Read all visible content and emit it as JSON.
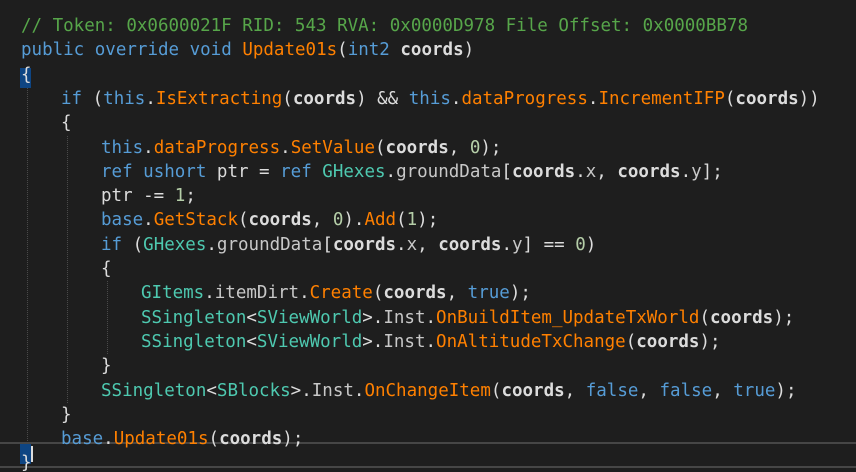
{
  "colors": {
    "background": "#1e1e1e",
    "comment": "#57a64a",
    "keyword": "#569cd6",
    "type": "#4ec9b0",
    "method": "#ff8000",
    "member": "#c8c8c8",
    "plain": "#dcdcdc",
    "number": "#b5cea8",
    "indent_guide": "#4a4a4a",
    "current_line_border": "#464646"
  },
  "code": {
    "lines": [
      {
        "indent": 0,
        "tokens": [
          [
            "c",
            "// Token: 0x0600021F RID: 543 RVA: 0x0000D978 File Offset: 0x0000BB78"
          ]
        ]
      },
      {
        "indent": 0,
        "tokens": [
          [
            "k",
            "public"
          ],
          [
            "p",
            " "
          ],
          [
            "k",
            "override"
          ],
          [
            "p",
            " "
          ],
          [
            "k",
            "void"
          ],
          [
            "p",
            " "
          ],
          [
            "m",
            "Update01s"
          ],
          [
            "p",
            "("
          ],
          [
            "k",
            "int2"
          ],
          [
            "p",
            " "
          ],
          [
            "b",
            "coords"
          ],
          [
            "p",
            ")"
          ]
        ]
      },
      {
        "indent": 0,
        "tokens": [
          [
            "p",
            "{"
          ]
        ]
      },
      {
        "indent": 1,
        "tokens": [
          [
            "k",
            "if"
          ],
          [
            "p",
            " ("
          ],
          [
            "k",
            "this"
          ],
          [
            "p",
            "."
          ],
          [
            "m",
            "IsExtracting"
          ],
          [
            "p",
            "("
          ],
          [
            "b",
            "coords"
          ],
          [
            "p",
            ") && "
          ],
          [
            "k",
            "this"
          ],
          [
            "p",
            "."
          ],
          [
            "f",
            "dataProgress"
          ],
          [
            "p",
            "."
          ],
          [
            "m",
            "IncrementIFP"
          ],
          [
            "p",
            "("
          ],
          [
            "b",
            "coords"
          ],
          [
            "p",
            "))"
          ]
        ]
      },
      {
        "indent": 1,
        "tokens": [
          [
            "p",
            "{"
          ]
        ]
      },
      {
        "indent": 2,
        "tokens": [
          [
            "k",
            "this"
          ],
          [
            "p",
            "."
          ],
          [
            "f",
            "dataProgress"
          ],
          [
            "p",
            "."
          ],
          [
            "m",
            "SetValue"
          ],
          [
            "p",
            "("
          ],
          [
            "b",
            "coords"
          ],
          [
            "p",
            ", "
          ],
          [
            "n",
            "0"
          ],
          [
            "p",
            ");"
          ]
        ]
      },
      {
        "indent": 2,
        "tokens": [
          [
            "k",
            "ref"
          ],
          [
            "p",
            " "
          ],
          [
            "k",
            "ushort"
          ],
          [
            "p",
            " ptr = "
          ],
          [
            "k",
            "ref"
          ],
          [
            "p",
            " "
          ],
          [
            "t",
            "GHexes"
          ],
          [
            "p",
            "."
          ],
          [
            "g",
            "groundData"
          ],
          [
            "p",
            "["
          ],
          [
            "b",
            "coords"
          ],
          [
            "p",
            "."
          ],
          [
            "g",
            "x"
          ],
          [
            "p",
            ", "
          ],
          [
            "b",
            "coords"
          ],
          [
            "p",
            "."
          ],
          [
            "g",
            "y"
          ],
          [
            "p",
            "];"
          ]
        ]
      },
      {
        "indent": 2,
        "tokens": [
          [
            "p",
            "ptr -= "
          ],
          [
            "n",
            "1"
          ],
          [
            "p",
            ";"
          ]
        ]
      },
      {
        "indent": 2,
        "tokens": [
          [
            "k",
            "base"
          ],
          [
            "p",
            "."
          ],
          [
            "m",
            "GetStack"
          ],
          [
            "p",
            "("
          ],
          [
            "b",
            "coords"
          ],
          [
            "p",
            ", "
          ],
          [
            "n",
            "0"
          ],
          [
            "p",
            ")."
          ],
          [
            "m",
            "Add"
          ],
          [
            "p",
            "("
          ],
          [
            "n",
            "1"
          ],
          [
            "p",
            ");"
          ]
        ]
      },
      {
        "indent": 2,
        "tokens": [
          [
            "k",
            "if"
          ],
          [
            "p",
            " ("
          ],
          [
            "t",
            "GHexes"
          ],
          [
            "p",
            "."
          ],
          [
            "g",
            "groundData"
          ],
          [
            "p",
            "["
          ],
          [
            "b",
            "coords"
          ],
          [
            "p",
            "."
          ],
          [
            "g",
            "x"
          ],
          [
            "p",
            ", "
          ],
          [
            "b",
            "coords"
          ],
          [
            "p",
            "."
          ],
          [
            "g",
            "y"
          ],
          [
            "p",
            "] == "
          ],
          [
            "n",
            "0"
          ],
          [
            "p",
            ")"
          ]
        ]
      },
      {
        "indent": 2,
        "tokens": [
          [
            "p",
            "{"
          ]
        ]
      },
      {
        "indent": 3,
        "tokens": [
          [
            "t",
            "GItems"
          ],
          [
            "p",
            "."
          ],
          [
            "g",
            "itemDirt"
          ],
          [
            "p",
            "."
          ],
          [
            "m",
            "Create"
          ],
          [
            "p",
            "("
          ],
          [
            "b",
            "coords"
          ],
          [
            "p",
            ", "
          ],
          [
            "k",
            "true"
          ],
          [
            "p",
            ");"
          ]
        ]
      },
      {
        "indent": 3,
        "tokens": [
          [
            "t",
            "SSingleton"
          ],
          [
            "p",
            "<"
          ],
          [
            "t",
            "SViewWorld"
          ],
          [
            "p",
            ">."
          ],
          [
            "g",
            "Inst"
          ],
          [
            "p",
            "."
          ],
          [
            "m",
            "OnBuildItem_UpdateTxWorld"
          ],
          [
            "p",
            "("
          ],
          [
            "b",
            "coords"
          ],
          [
            "p",
            ");"
          ]
        ]
      },
      {
        "indent": 3,
        "tokens": [
          [
            "t",
            "SSingleton"
          ],
          [
            "p",
            "<"
          ],
          [
            "t",
            "SViewWorld"
          ],
          [
            "p",
            ">."
          ],
          [
            "g",
            "Inst"
          ],
          [
            "p",
            "."
          ],
          [
            "m",
            "OnAltitudeTxChange"
          ],
          [
            "p",
            "("
          ],
          [
            "b",
            "coords"
          ],
          [
            "p",
            ");"
          ]
        ]
      },
      {
        "indent": 2,
        "tokens": [
          [
            "p",
            "}"
          ]
        ]
      },
      {
        "indent": 2,
        "tokens": [
          [
            "t",
            "SSingleton"
          ],
          [
            "p",
            "<"
          ],
          [
            "t",
            "SBlocks"
          ],
          [
            "p",
            ">."
          ],
          [
            "g",
            "Inst"
          ],
          [
            "p",
            "."
          ],
          [
            "m",
            "OnChangeItem"
          ],
          [
            "p",
            "("
          ],
          [
            "b",
            "coords"
          ],
          [
            "p",
            ", "
          ],
          [
            "k",
            "false"
          ],
          [
            "p",
            ", "
          ],
          [
            "k",
            "false"
          ],
          [
            "p",
            ", "
          ],
          [
            "k",
            "true"
          ],
          [
            "p",
            ");"
          ]
        ]
      },
      {
        "indent": 1,
        "tokens": [
          [
            "p",
            "}"
          ]
        ]
      },
      {
        "indent": 1,
        "tokens": [
          [
            "k",
            "base"
          ],
          [
            "p",
            "."
          ],
          [
            "m",
            "Update01s"
          ],
          [
            "p",
            "("
          ],
          [
            "b",
            "coords"
          ],
          [
            "p",
            ");"
          ]
        ]
      },
      {
        "indent": 0,
        "tokens": [
          [
            "p",
            "}"
          ]
        ]
      }
    ]
  }
}
